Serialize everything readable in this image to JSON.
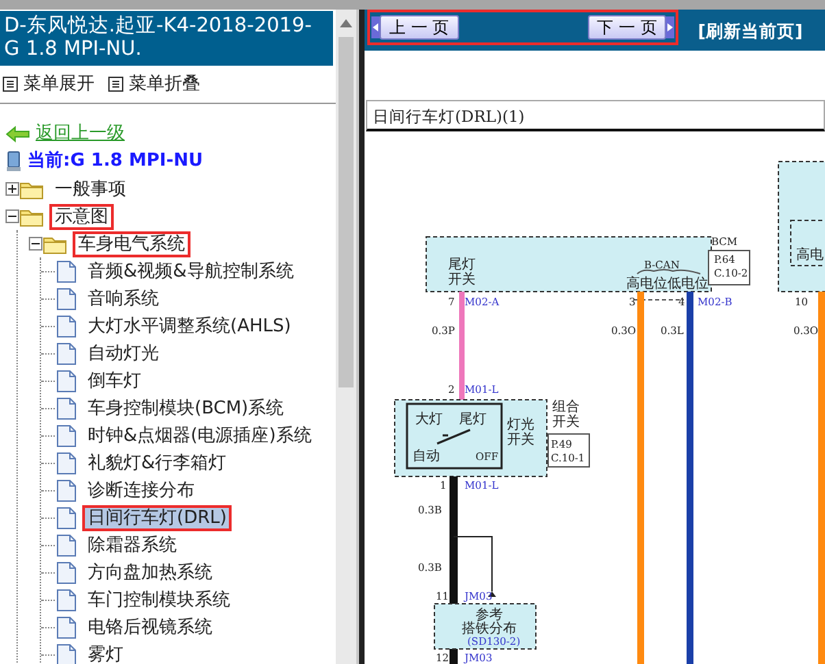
{
  "left": {
    "title": "D-东风悦达.起亚-K4-2018-2019- G 1.8 MPI-NU.",
    "menu": [
      {
        "label": "菜单展开"
      },
      {
        "label": "菜单折叠"
      }
    ],
    "back_link": "返回上一级",
    "current": "当前:G 1.8 MPI-NU",
    "tree": [
      {
        "label": "一般事项",
        "kind": "folder",
        "expanded": false,
        "selected": false,
        "marked": false
      },
      {
        "label": "示意图",
        "kind": "folder",
        "expanded": true,
        "selected": false,
        "marked": true,
        "children": [
          {
            "label": "车身电气系统",
            "kind": "folder",
            "expanded": true,
            "selected": false,
            "marked": true,
            "children": [
              {
                "label": "音频&视频&导航控制系统",
                "kind": "page",
                "selected": false,
                "marked": false
              },
              {
                "label": "音响系统",
                "kind": "page",
                "selected": false,
                "marked": false
              },
              {
                "label": "大灯水平调整系统(AHLS)",
                "kind": "page",
                "selected": false,
                "marked": false
              },
              {
                "label": "自动灯光",
                "kind": "page",
                "selected": false,
                "marked": false
              },
              {
                "label": "倒车灯",
                "kind": "page",
                "selected": false,
                "marked": false
              },
              {
                "label": "车身控制模块(BCM)系统",
                "kind": "page",
                "selected": false,
                "marked": false
              },
              {
                "label": "时钟&点烟器(电源插座)系统",
                "kind": "page",
                "selected": false,
                "marked": false
              },
              {
                "label": "礼貌灯&行李箱灯",
                "kind": "page",
                "selected": false,
                "marked": false
              },
              {
                "label": "诊断连接分布",
                "kind": "page",
                "selected": false,
                "marked": false
              },
              {
                "label": "日间行车灯(DRL)",
                "kind": "page",
                "selected": true,
                "marked": true
              },
              {
                "label": "除霜器系统",
                "kind": "page",
                "selected": false,
                "marked": false
              },
              {
                "label": "方向盘加热系统",
                "kind": "page",
                "selected": false,
                "marked": false
              },
              {
                "label": "车门控制模块系统",
                "kind": "page",
                "selected": false,
                "marked": false
              },
              {
                "label": "电铬后视镜系统",
                "kind": "page",
                "selected": false,
                "marked": false
              },
              {
                "label": "雾灯",
                "kind": "page",
                "selected": false,
                "marked": false
              }
            ]
          }
        ]
      }
    ]
  },
  "right": {
    "pager": {
      "prev": "上 一 页",
      "next": "下 一 页",
      "marked": true
    },
    "refresh": "[刷新当前页]",
    "document": {
      "title": "日间行车灯(DRL)(1)",
      "diagram_texts": [
        "BCM",
        "尾灯",
        "B-CAN",
        "P.64",
        "高电",
        "C.10-2",
        "开关",
        "高电位",
        "低电位",
        "7",
        "M02-A",
        "3",
        "4",
        "M02-B",
        "10",
        "0.3P",
        "0.3O",
        "0.3L",
        "0.3O",
        "2",
        "M01-L",
        "组合",
        "大灯",
        "尾灯",
        "灯光",
        "开关",
        "开关",
        "P.49",
        "自动",
        "OFF",
        "C.10-1",
        "1",
        "M01-L",
        "0.3B",
        "0.3B",
        "11",
        "JM03",
        "参考",
        "搭铁分布",
        "(SD130-2)",
        "12",
        "JM03"
      ]
    }
  }
}
